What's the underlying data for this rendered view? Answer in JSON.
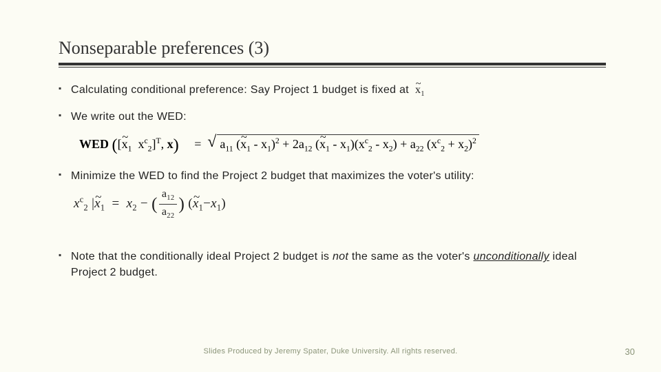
{
  "title": "Nonseparable preferences (3)",
  "bullets": {
    "b1_prefix": "Calculating conditional preference: Say Project 1 budget is fixed at",
    "b2": "We write out the WED:",
    "b3": "Minimize the WED to find the Project 2 budget that maximizes the voter's utility:",
    "b4_a": "Note that the conditionally ideal Project 2 budget is ",
    "b4_not": "not",
    "b4_b": " the same as the voter's ",
    "b4_unc": "unconditionally",
    "b4_c": "  ideal Project 2 budget."
  },
  "formula": {
    "wed_label": "WED",
    "wed_lhs_open": "(",
    "wed_lhs_vec_open": "[",
    "wed_x1tilde": "x",
    "wed_x1tilde_sub": "1",
    "wed_x2c": "x",
    "wed_x2c_sub": "2",
    "wed_x2c_sup": "c",
    "wed_lhs_vec_close": "]",
    "wed_lhs_T": "T",
    "wed_comma": ", ",
    "wed_x": "x",
    "wed_lhs_close": ")",
    "eq": "=",
    "a11": "a",
    "a11_sub": "11",
    "a12": "a",
    "a12_sub": "12",
    "a22": "a",
    "a22_sub": "22",
    "x1t": "x",
    "x1t_sub": "1",
    "x1": "x",
    "x1_sub": "1",
    "x2c2": "x",
    "x2c2_sub": "2",
    "x2c2_sup": "c",
    "x2": "x",
    "x2_sub": "2",
    "plus2": "+ 2",
    "plus": "+",
    "minus": "-",
    "sq": "2"
  },
  "formula2": {
    "lhs_x2c": "x",
    "lhs_x2c_sub": "2",
    "lhs_x2c_sup": "c",
    "bar": "|",
    "x1t": "x",
    "x1t_sub": "1",
    "eq": "=",
    "x2": "x",
    "x2_sub": "2",
    "minus": "−",
    "a12": "a",
    "a12_sub": "12",
    "a22": "a",
    "a22_sub": "22",
    "x1": "x",
    "x1_sub": "1"
  },
  "footer": "Slides Produced by Jeremy Spater, Duke University.  All rights reserved.",
  "page": "30"
}
